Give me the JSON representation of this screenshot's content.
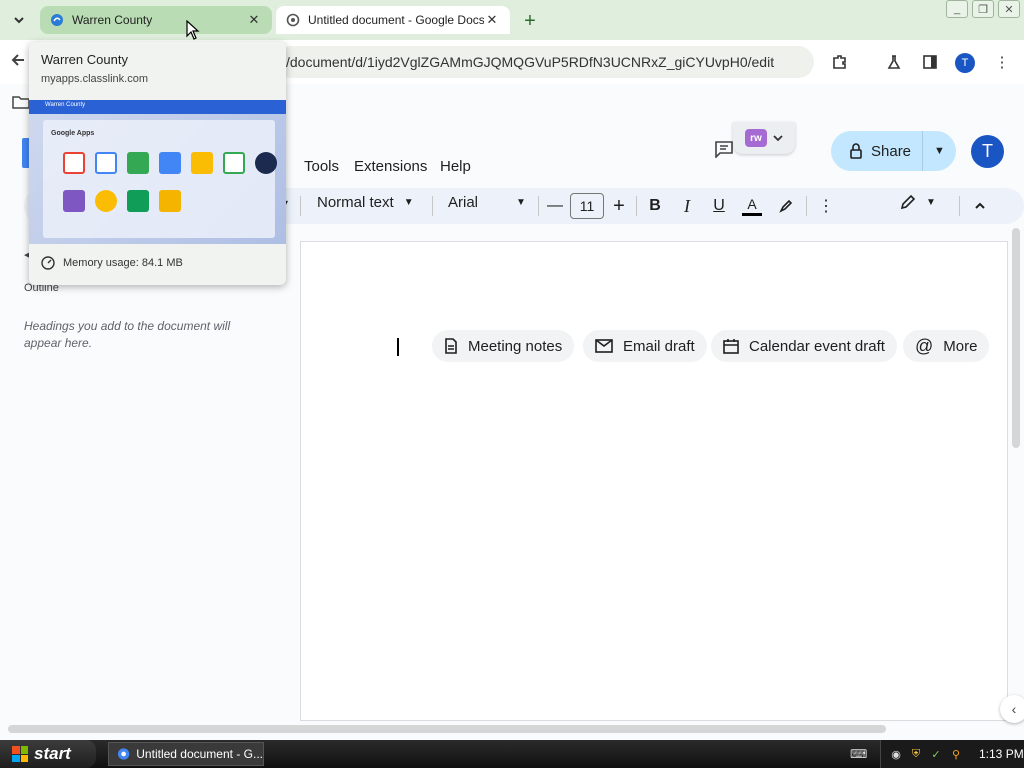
{
  "browser": {
    "tabs": [
      {
        "title": "Warren County",
        "state": "hover"
      },
      {
        "title": "Untitled document - Google Docs",
        "state": "active"
      }
    ],
    "new_tab_label": "+",
    "url": "/document/d/1iyd2VglZGAMmGJQMQGVuP5RDfN3UCNRxZ_giCYUvpH0/edit",
    "profile_initial": "T"
  },
  "hover_card": {
    "title": "Warren County",
    "url": "myapps.classlink.com",
    "preview_app_name": "Warren County",
    "preview_section": "Google Apps",
    "memory": "Memory usage: 84.1 MB"
  },
  "docs": {
    "menu": [
      "Tools",
      "Extensions",
      "Help"
    ],
    "extension_badge": "rw",
    "share_label": "Share",
    "account_initial": "T",
    "toolbar": {
      "style": "Normal text",
      "font": "Arial",
      "size": "11",
      "bold": "B",
      "italic": "I",
      "underline": "U",
      "text_color": "A"
    },
    "outline": {
      "title": "Outline",
      "hint": "Headings you add to the document will appear here."
    },
    "chips": [
      {
        "label": "Meeting notes",
        "icon": "document-icon"
      },
      {
        "label": "Email draft",
        "icon": "email-icon"
      },
      {
        "label": "Calendar event draft",
        "icon": "calendar-icon"
      },
      {
        "label": "More",
        "icon": "at-icon"
      }
    ]
  },
  "taskbar": {
    "start_label": "start",
    "task_item": "Untitled document - G...",
    "clock": "1:13 PM"
  },
  "colors": {
    "tabstrip": "#dfeedd",
    "share_button": "#c2e7ff",
    "account": "#1a55c4"
  }
}
